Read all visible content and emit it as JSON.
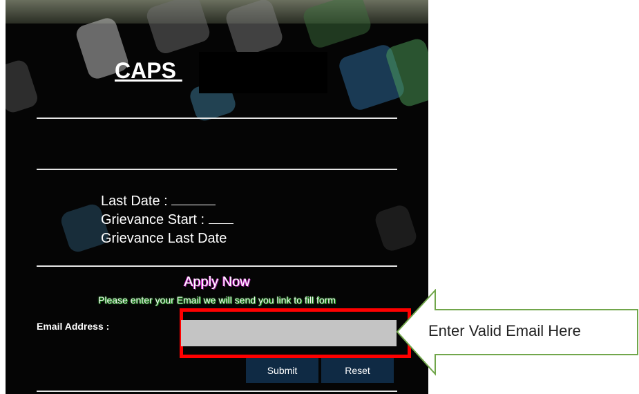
{
  "header": {
    "title": "CAPS "
  },
  "dates": {
    "last_date_label": "Last Date :",
    "grievance_start_label": "Grievance Start :",
    "grievance_last_label": "Grievance Last Date"
  },
  "apply": {
    "heading": "Apply Now",
    "instruction": "Please enter your Email we will send you link to fill form"
  },
  "form": {
    "email_label": "Email Address :",
    "email_value": "",
    "email_placeholder": "",
    "submit_label": "Submit",
    "reset_label": "Reset"
  },
  "callout": {
    "text": "Enter Valid Email Here"
  },
  "colors": {
    "panel_bg": "#050505",
    "input_bg": "#c4c4c4",
    "button_bg": "#0f2a44",
    "highlight": "#ff0000",
    "callout_border": "#71a64b"
  }
}
